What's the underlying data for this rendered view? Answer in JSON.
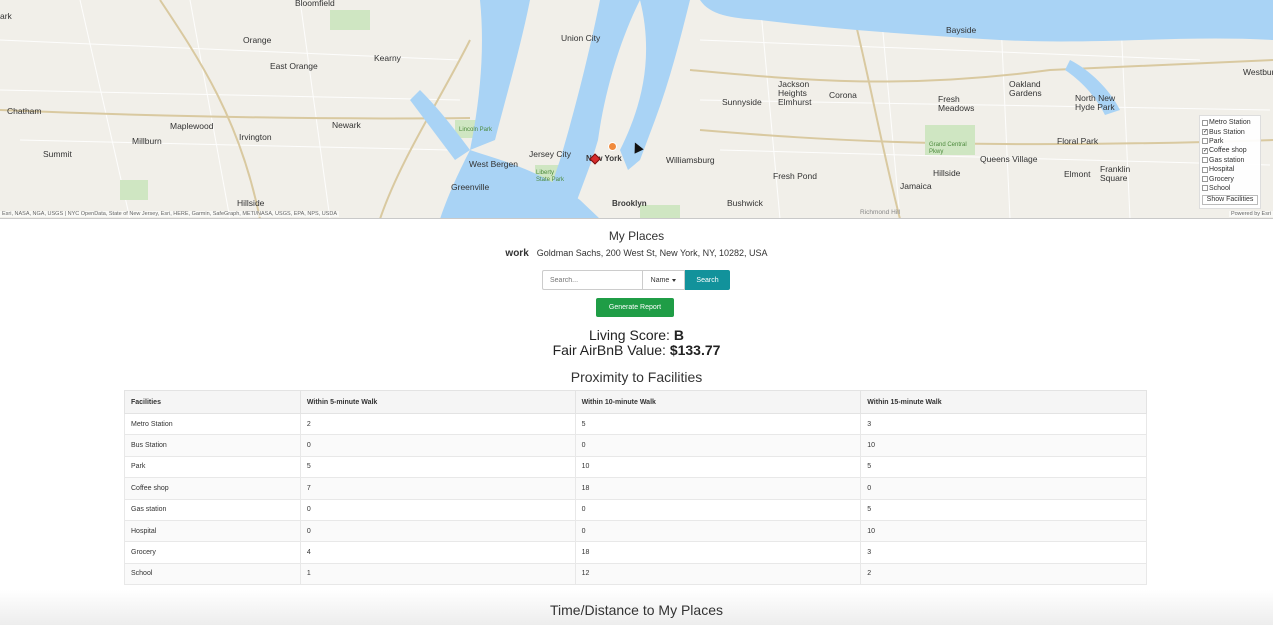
{
  "map": {
    "labels": {
      "east_orange": "East Orange",
      "orange": "Orange",
      "kearny": "Kearny",
      "newark": "Newark",
      "irvington": "Irvington",
      "maplewood": "Maplewood",
      "millburn": "Millburn",
      "summit": "Summit",
      "chatham": "Chatham",
      "hillside_nj": "Hillside",
      "union_city": "Union City",
      "jersey_city": "Jersey City",
      "west_bergen": "West Bergen",
      "greenville": "Greenville",
      "new_york": "New York",
      "williamsburg": "Williamsburg",
      "brooklyn": "Brooklyn",
      "bushwick": "Bushwick",
      "sunnyside": "Sunnyside",
      "jackson_heights": "Jackson Heights Elmhurst",
      "corona": "Corona",
      "fresh_pond": "Fresh Pond",
      "jamaica": "Jamaica",
      "hillside_ny": "Hillside",
      "queens_village": "Queens Village",
      "elmont": "Elmont",
      "franklin_square": "Franklin Square",
      "floral_park": "Floral Park",
      "fresh_meadows": "Fresh Meadows",
      "oakland_gardens": "Oakland Gardens",
      "north_new_hyde_park": "North New Hyde Park",
      "bayside": "Bayside",
      "westbury": "Westbury",
      "bloomfield": "Bloomfield",
      "liberty_state_park": "Liberty State Park",
      "lincoln_park": "Lincoln Park",
      "grand_central_pkwy": "Grand Central Pkwy",
      "richmond_hill": "Richmond Hill",
      "ark": "ark"
    },
    "attribution_left": "Esri, NASA, NGA, USGS | NYC OpenData, State of New Jersey, Esri, HERE, Garmin, SafeGraph, METI/NASA, USGS, EPA, NPS, USDA",
    "attribution_right": "Powered by Esri",
    "layers": [
      {
        "label": "Metro Station",
        "checked": false
      },
      {
        "label": "Bus Station",
        "checked": true
      },
      {
        "label": "Park",
        "checked": false
      },
      {
        "label": "Coffee shop",
        "checked": true
      },
      {
        "label": "Gas station",
        "checked": false
      },
      {
        "label": "Hospital",
        "checked": false
      },
      {
        "label": "Grocery",
        "checked": false
      },
      {
        "label": "School",
        "checked": false
      }
    ],
    "show_facilities_label": "Show Facilities",
    "colors": {
      "water": "#a9d3f5",
      "land": "#f1efe9",
      "park": "#cfe6c2",
      "marker_work": "#d62b2b",
      "marker_facility": "#f08a3c"
    }
  },
  "title": "My Places",
  "place": {
    "name": "work",
    "address": "Goldman Sachs, 200 West St, New York, NY, 10282, USA"
  },
  "search": {
    "placeholder": "Search...",
    "select_value": "Name",
    "button_label": "Search"
  },
  "report_button_label": "Generate Report",
  "living_score": {
    "label": "Living Score:",
    "value": "B"
  },
  "airbnb": {
    "label": "Fair AirBnB Value:",
    "value": "$133.77"
  },
  "proximity_title": "Proximity to Facilities",
  "table": {
    "headers": [
      "Facilities",
      "Within 5-minute Walk",
      "Within 10-minute Walk",
      "Within 15-minute Walk"
    ],
    "rows": [
      [
        "Metro Station",
        "2",
        "5",
        "3"
      ],
      [
        "Bus Station",
        "0",
        "0",
        "10"
      ],
      [
        "Park",
        "5",
        "10",
        "5"
      ],
      [
        "Coffee shop",
        "7",
        "18",
        "0"
      ],
      [
        "Gas station",
        "0",
        "0",
        "5"
      ],
      [
        "Hospital",
        "0",
        "0",
        "10"
      ],
      [
        "Grocery",
        "4",
        "18",
        "3"
      ],
      [
        "School",
        "1",
        "12",
        "2"
      ]
    ]
  },
  "time_distance_title": "Time/Distance to My Places",
  "colors": {
    "search_button": "#12929b",
    "report_button": "#1f9d46"
  }
}
